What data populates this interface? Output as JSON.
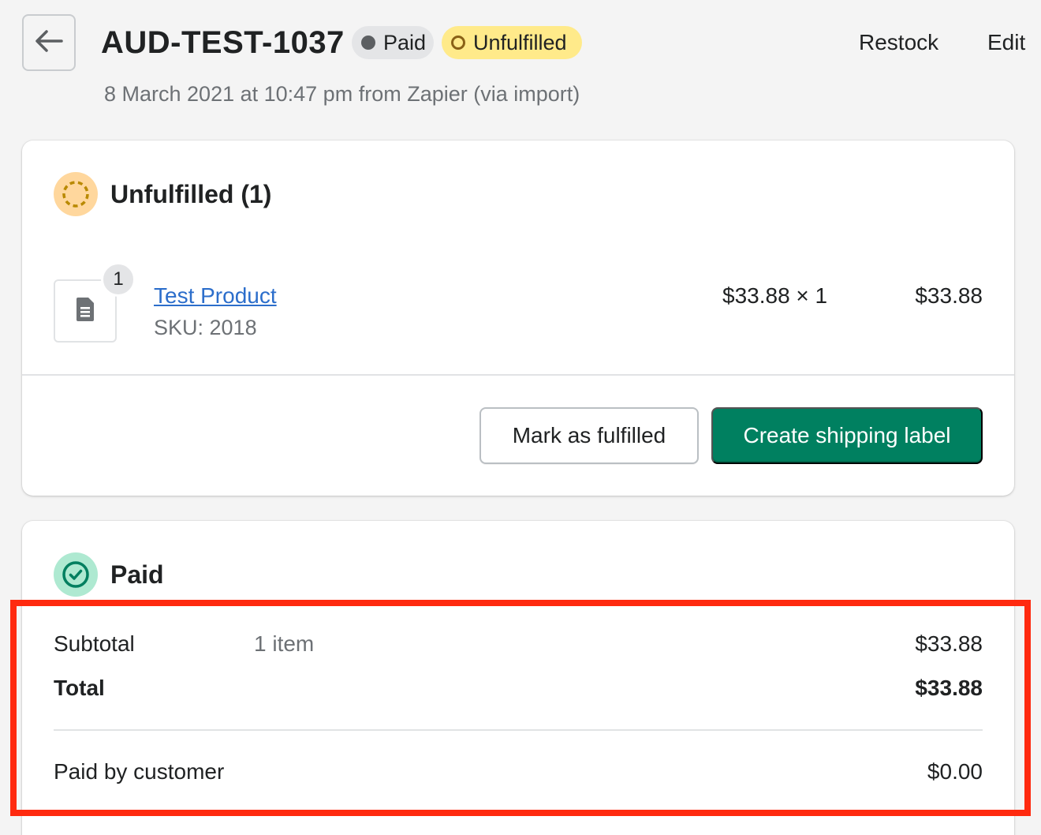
{
  "header": {
    "title": "AUD-TEST-1037",
    "badges": {
      "paid": "Paid",
      "unfulfilled": "Unfulfilled"
    },
    "actions": {
      "restock": "Restock",
      "edit": "Edit"
    },
    "subtitle": "8 March 2021 at 10:47 pm from Zapier (via import)"
  },
  "fulfillment_card": {
    "heading": "Unfulfilled (1)",
    "item": {
      "quantity_badge": "1",
      "name": "Test Product",
      "sku": "SKU: 2018",
      "unit_price": "$33.88 × 1",
      "line_total": "$33.88"
    },
    "buttons": {
      "mark_fulfilled": "Mark as fulfilled",
      "create_label": "Create shipping label"
    }
  },
  "payment_card": {
    "heading": "Paid",
    "subtotal": {
      "label": "Subtotal",
      "detail": "1 item",
      "value": "$33.88"
    },
    "total": {
      "label": "Total",
      "value": "$33.88"
    },
    "paid_by_customer": {
      "label": "Paid by customer",
      "value": "$0.00"
    }
  },
  "icons": {
    "back": "arrow-left-icon",
    "unfulfilled_status": "dashed-circle-icon",
    "paid_status": "check-circle-icon",
    "product_placeholder": "document-icon"
  },
  "colors": {
    "primary_button": "#008060",
    "link": "#2c6ecb",
    "unfulfilled_badge": "#ffea8a",
    "paid_badge": "#e4e5e7",
    "highlight": "#ff2a0f"
  }
}
